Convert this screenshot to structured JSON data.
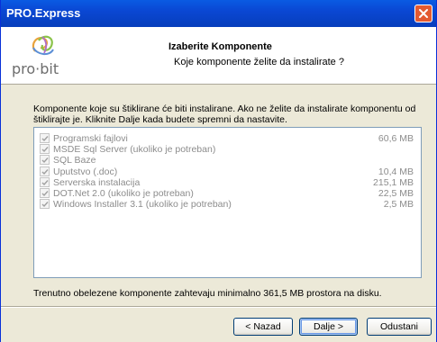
{
  "window": {
    "title": "PRO.Express"
  },
  "header": {
    "logo_text": "pro·bit",
    "title": "Izaberite Komponente",
    "subtitle": "Koje komponente želite da instalirate ?"
  },
  "description": "Komponente koje su štiklirane će biti instalirane. Ako ne želite da instalirate komponentu od štiklirajte je. Kliknite Dalje kada budete spremni da nastavite.",
  "components": [
    {
      "label": "Programski fajlovi",
      "size": "60,6 MB",
      "checked": true
    },
    {
      "label": "MSDE Sql Server (ukoliko je potreban)",
      "size": "",
      "checked": true
    },
    {
      "label": "SQL Baze",
      "size": "",
      "checked": true
    },
    {
      "label": "Uputstvo (.doc)",
      "size": "10,4 MB",
      "checked": true
    },
    {
      "label": "Serverska instalacija",
      "size": "215,1 MB",
      "checked": true
    },
    {
      "label": "DOT.Net 2.0 (ukoliko je potreban)",
      "size": "22,5 MB",
      "checked": true
    },
    {
      "label": "Windows Installer 3.1 (ukoliko je potreban)",
      "size": "2,5 MB",
      "checked": true
    }
  ],
  "footer_text": "Trenutno obelezene komponente zahtevaju minimalno 361,5 MB prostora na disku.",
  "buttons": {
    "back": "< Nazad",
    "next": "Dalje >",
    "cancel": "Odustani"
  }
}
